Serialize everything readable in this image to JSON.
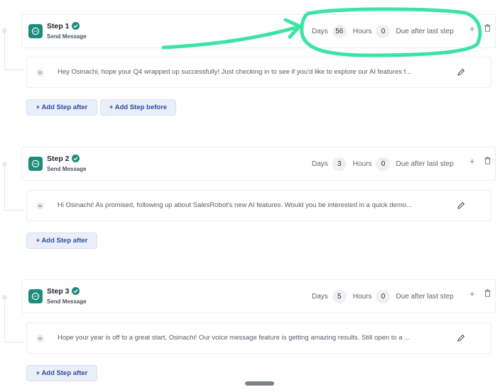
{
  "steps": [
    {
      "title": "Step 1",
      "subtitle": "Send Message",
      "days_label": "Days",
      "days_value": "56",
      "hours_label": "Hours",
      "hours_value": "0",
      "due_label": "Due after last step",
      "message": "Hey Osinachi, hope your Q4 wrapped up successfully! Just checking in to see if you'd like to explore our AI features f...",
      "add_after": "+ Add Step after",
      "add_before": "+ Add Step before"
    },
    {
      "title": "Step 2",
      "subtitle": "Send Message",
      "days_label": "Days",
      "days_value": "3",
      "hours_label": "Hours",
      "hours_value": "0",
      "due_label": "Due after last step",
      "message": "Hi Osinachi! As promised, following up about SalesRobot's new AI features. Would you be interested in a quick demo...",
      "add_after": "+ Add Step after"
    },
    {
      "title": "Step 3",
      "subtitle": "Send Message",
      "days_label": "Days",
      "days_value": "5",
      "hours_label": "Hours",
      "hours_value": "0",
      "due_label": "Due after last step",
      "message": "Hope your year is off to a great start, Osinachi! Our voice message feature is getting amazing results. Still open to a ...",
      "add_after": "+ Add Step after"
    }
  ],
  "colors": {
    "step_icon": "#1e8c7b",
    "annotation": "#3de3a4",
    "button_bg": "#e9eef9",
    "button_text": "#2f4d9c"
  },
  "icons": [
    "chat-bubble-icon",
    "verified-check-icon",
    "plus-icon",
    "trash-icon",
    "drag-handle-icon",
    "pencil-icon"
  ]
}
